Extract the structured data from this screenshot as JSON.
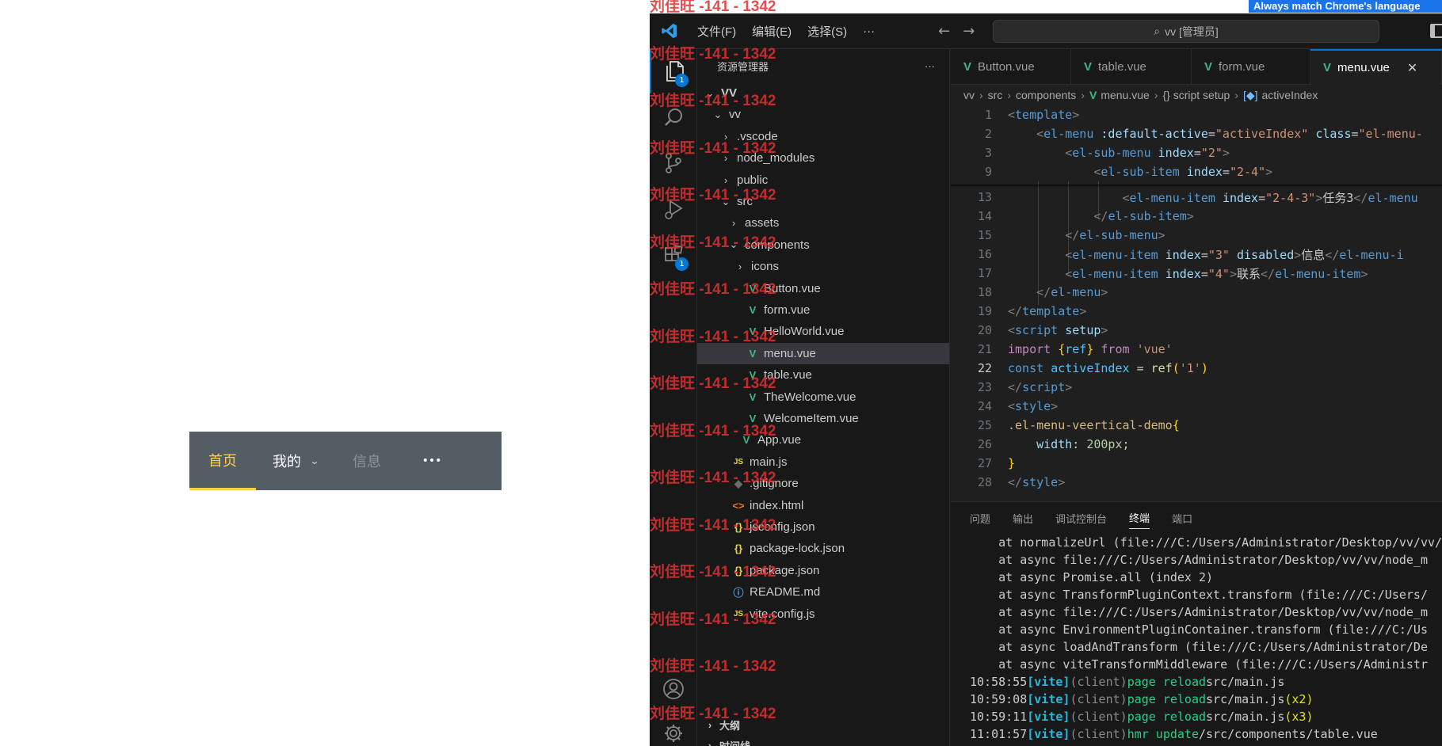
{
  "demo_menu": {
    "items": [
      {
        "label": "首页"
      },
      {
        "label": "我的"
      },
      {
        "label": "信息"
      },
      {
        "label": "•••"
      }
    ]
  },
  "chrome_hint": "Always match Chrome's language",
  "watermark": "刘佳旺 -141 - 1342",
  "titlebar": {
    "menus": [
      "文件(F)",
      "编辑(E)",
      "选择(S)",
      "···"
    ],
    "search": "vv [管理员]"
  },
  "activity_badges": {
    "explorer": "1",
    "extensions": "1"
  },
  "explorer": {
    "title": "资源管理器",
    "more": "···",
    "tree": [
      {
        "label": "VV",
        "twisty": "⌄",
        "icon": ""
      },
      {
        "label": "vv",
        "twisty": "⌄",
        "icon": ""
      },
      {
        "label": ".vscode",
        "twisty": "›",
        "icon": ""
      },
      {
        "label": "node_modules",
        "twisty": "›",
        "icon": ""
      },
      {
        "label": "public",
        "twisty": "›",
        "icon": ""
      },
      {
        "label": "src",
        "twisty": "⌄",
        "icon": ""
      },
      {
        "label": "assets",
        "twisty": "›",
        "icon": ""
      },
      {
        "label": "components",
        "twisty": "⌄",
        "icon": ""
      },
      {
        "label": "icons",
        "twisty": "›",
        "icon": ""
      },
      {
        "label": "Button.vue",
        "twisty": "",
        "icon": "V"
      },
      {
        "label": "form.vue",
        "twisty": "",
        "icon": "V"
      },
      {
        "label": "HelloWorld.vue",
        "twisty": "",
        "icon": "V"
      },
      {
        "label": "menu.vue",
        "twisty": "",
        "icon": "V"
      },
      {
        "label": "table.vue",
        "twisty": "",
        "icon": "V"
      },
      {
        "label": "TheWelcome.vue",
        "twisty": "",
        "icon": "V"
      },
      {
        "label": "WelcomeItem.vue",
        "twisty": "",
        "icon": "V"
      },
      {
        "label": "App.vue",
        "twisty": "",
        "icon": "V"
      },
      {
        "label": "main.js",
        "twisty": "",
        "icon": "JS"
      },
      {
        "label": ".gitignore",
        "twisty": "",
        "icon": "◆"
      },
      {
        "label": "index.html",
        "twisty": "",
        "icon": "<>"
      },
      {
        "label": "jsconfig.json",
        "twisty": "",
        "icon": "{}"
      },
      {
        "label": "package-lock.json",
        "twisty": "",
        "icon": "{}"
      },
      {
        "label": "package.json",
        "twisty": "",
        "icon": "{}"
      },
      {
        "label": "README.md",
        "twisty": "",
        "icon": "ⓘ"
      },
      {
        "label": "vite.config.js",
        "twisty": "",
        "icon": "JS"
      }
    ],
    "outline": "大纲",
    "timeline": "时间线"
  },
  "tabs": [
    "Button.vue",
    "table.vue",
    "form.vue",
    "menu.vue"
  ],
  "tab_close": "✕",
  "breadcrumb": [
    "vv",
    "src",
    "components",
    "menu.vue",
    "{} script setup",
    "activeIndex"
  ],
  "code": {
    "line_numbers": [
      "1",
      "2",
      "3",
      "9",
      "13",
      "14",
      "15",
      "16",
      "17",
      "18",
      "19",
      "20",
      "21",
      "22",
      "23",
      "24",
      "25",
      "26",
      "27",
      "28"
    ],
    "current_line": "22"
  },
  "panel": {
    "tabs": [
      "问题",
      "输出",
      "调试控制台",
      "终端",
      "端口"
    ],
    "terminal": [
      "    at normalizeUrl (file:///C:/Users/Administrator/Desktop/vv/vv/",
      "    at async file:///C:/Users/Administrator/Desktop/vv/vv/node_m",
      "    at async Promise.all (index 2)",
      "    at async TransformPluginContext.transform (file:///C:/Users/",
      "    at async file:///C:/Users/Administrator/Desktop/vv/vv/node_m",
      "    at async EnvironmentPluginContainer.transform (file:///C:/Us",
      "    at async loadAndTransform (file:///C:/Users/Administrator/De",
      "    at async viteTransformMiddleware (file:///C:/Users/Administr"
    ],
    "logs": [
      {
        "time": "10:58:55",
        "tag": "[vite]",
        "client": "(client)",
        "action": "page reload",
        "path": "src/main.js",
        "count": ""
      },
      {
        "time": "10:59:08",
        "tag": "[vite]",
        "client": "(client)",
        "action": "page reload",
        "path": "src/main.js",
        "count": "(x2)"
      },
      {
        "time": "10:59:11",
        "tag": "[vite]",
        "client": "(client)",
        "action": "page reload",
        "path": "src/main.js",
        "count": "(x3)"
      },
      {
        "time": "11:01:57",
        "tag": "[vite]",
        "client": "(client)",
        "action": "hmr update",
        "path": "/src/components/table.vue",
        "count": ""
      }
    ]
  }
}
